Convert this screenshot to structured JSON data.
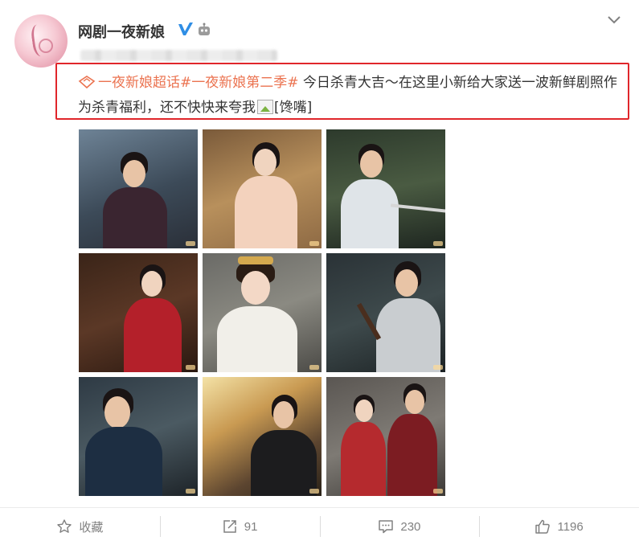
{
  "account": {
    "username": "网剧一夜新娘",
    "avatar_icon": "avatar-image",
    "verified_icon": "verified-v-icon",
    "robot_icon": "robot-badge-icon"
  },
  "post": {
    "topic1": "一夜新娘超话",
    "topic2": "#一夜新娘第二季#",
    "text1": " 今日杀青大吉～在这里小新给大家送一波新鲜剧照作为杀青福利，还不快快来夸我",
    "emoji_alt": "[馋嘴]",
    "highlight_color": "#e0262b",
    "topic_color": "#eb7350"
  },
  "photos": [
    {
      "label": "still-1"
    },
    {
      "label": "still-2"
    },
    {
      "label": "still-3"
    },
    {
      "label": "still-4"
    },
    {
      "label": "still-5"
    },
    {
      "label": "still-6"
    },
    {
      "label": "still-7"
    },
    {
      "label": "still-8"
    },
    {
      "label": "still-9"
    }
  ],
  "actions": {
    "favorite_label": "收藏",
    "repost_count": "91",
    "comment_count": "230",
    "like_count": "1196"
  }
}
